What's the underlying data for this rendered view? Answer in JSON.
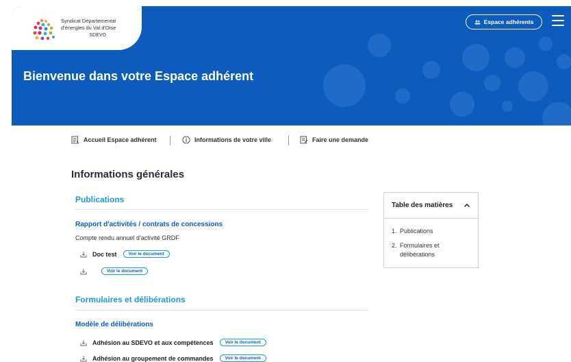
{
  "logo": {
    "line1": "Syndicat Départemental",
    "line2": "d'énergies du Val d'Oise",
    "line3": "SDEVO"
  },
  "header": {
    "member_button_label": "Espace adhérents",
    "hero_title": "Bienvenue dans votre Espace adhérent"
  },
  "subnav": {
    "items": [
      {
        "label": "Accueil Espace adhérent",
        "icon": "document-icon"
      },
      {
        "label": "Informations de votre ville",
        "icon": "info-icon"
      },
      {
        "label": "Faire une demande",
        "icon": "form-icon"
      }
    ]
  },
  "main": {
    "title": "Informations générales",
    "sections": [
      {
        "title": "Publications",
        "subsection": "Rapport d'activités / contrats de concessions",
        "description": "Compte rendu annuel d'activité GRDF",
        "docs": [
          {
            "name": "Doc test",
            "button": "Voir le document"
          },
          {
            "name": "",
            "button": "Voir le document"
          }
        ]
      },
      {
        "title": "Formulaires et délibérations",
        "subsection": "Modèle de délibérations",
        "docs": [
          {
            "name": "Adhésion au SDEVO et aux compétences",
            "button": "Voir le document"
          },
          {
            "name": "Adhésion au groupement de commandes",
            "button": "Voir le document"
          }
        ]
      }
    ]
  },
  "toc": {
    "title": "Table des matières",
    "items": [
      {
        "num": "1.",
        "label": "Publications"
      },
      {
        "num": "2.",
        "label": "Formulaires et délibérations"
      }
    ]
  },
  "colors": {
    "hero": "#0d5cbd",
    "accent": "#1a9ad6",
    "link": "#0d5cbd"
  }
}
